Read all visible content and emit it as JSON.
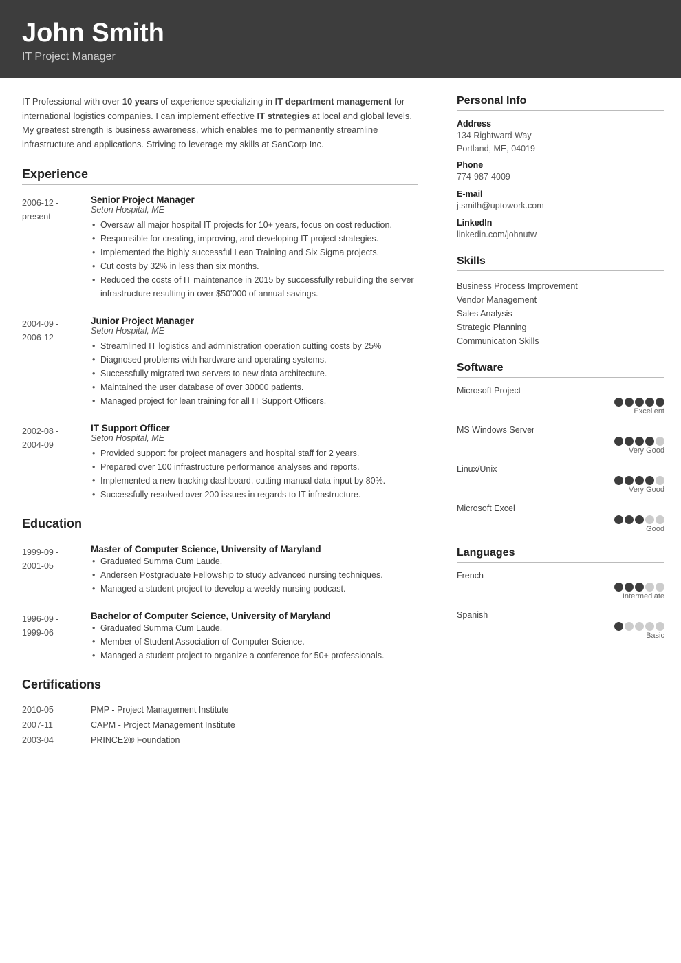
{
  "header": {
    "name": "John Smith",
    "title": "IT Project Manager"
  },
  "summary": {
    "text_parts": [
      {
        "text": "IT Professional with over ",
        "bold": false
      },
      {
        "text": "10 years",
        "bold": true
      },
      {
        "text": " of experience specializing in ",
        "bold": false
      },
      {
        "text": "IT department management",
        "bold": true
      },
      {
        "text": " for international logistics companies. I can implement effective ",
        "bold": false
      },
      {
        "text": "IT strategies",
        "bold": true
      },
      {
        "text": " at local and global levels. My greatest strength is business awareness, which enables me to permanently streamline infrastructure and applications. Striving to leverage my skills at SanCorp Inc.",
        "bold": false
      }
    ]
  },
  "sections": {
    "experience_title": "Experience",
    "education_title": "Education",
    "certifications_title": "Certifications"
  },
  "experience": [
    {
      "date_from": "2006-12 -",
      "date_to": "present",
      "role": "Senior Project Manager",
      "company": "Seton Hospital, ME",
      "bullets": [
        "Oversaw all major hospital IT projects for 10+ years, focus on cost reduction.",
        "Responsible for creating, improving, and developing IT project strategies.",
        "Implemented the highly successful Lean Training and Six Sigma projects.",
        "Cut costs by 32% in less than six months.",
        "Reduced the costs of IT maintenance in 2015 by successfully rebuilding the server infrastructure resulting in over $50'000 of annual savings."
      ]
    },
    {
      "date_from": "2004-09 -",
      "date_to": "2006-12",
      "role": "Junior Project Manager",
      "company": "Seton Hospital, ME",
      "bullets": [
        "Streamlined IT logistics and administration operation cutting costs by 25%",
        "Diagnosed problems with hardware and operating systems.",
        "Successfully migrated two servers to new data architecture.",
        "Maintained the user database of over 30000 patients.",
        "Managed project for lean training for all IT Support Officers."
      ]
    },
    {
      "date_from": "2002-08 -",
      "date_to": "2004-09",
      "role": "IT Support Officer",
      "company": "Seton Hospital, ME",
      "bullets": [
        "Provided support for project managers and hospital staff for 2 years.",
        "Prepared over 100 infrastructure performance analyses and reports.",
        "Implemented a new tracking dashboard, cutting manual data input by 80%.",
        "Successfully resolved over 200 issues in regards to IT infrastructure."
      ]
    }
  ],
  "education": [
    {
      "date_from": "1999-09 -",
      "date_to": "2001-05",
      "role": "Master of Computer Science, University of Maryland",
      "company": null,
      "bullets": [
        "Graduated Summa Cum Laude.",
        "Andersen Postgraduate Fellowship to study advanced nursing techniques.",
        "Managed a student project to develop a weekly nursing podcast."
      ]
    },
    {
      "date_from": "1996-09 -",
      "date_to": "1999-06",
      "role": "Bachelor of Computer Science, University of Maryland",
      "company": null,
      "bullets": [
        "Graduated Summa Cum Laude.",
        "Member of Student Association of Computer Science.",
        "Managed a student project to organize a conference for 50+ professionals."
      ]
    }
  ],
  "certifications": [
    {
      "date": "2010-05",
      "name": "PMP - Project Management Institute"
    },
    {
      "date": "2007-11",
      "name": "CAPM - Project Management Institute"
    },
    {
      "date": "2003-04",
      "name": "PRINCE2® Foundation"
    }
  ],
  "right": {
    "personal_info_title": "Personal Info",
    "personal_info": [
      {
        "label": "Address",
        "value": "134 Rightward Way\nPortland, ME, 04019"
      },
      {
        "label": "Phone",
        "value": "774-987-4009"
      },
      {
        "label": "E-mail",
        "value": "j.smith@uptowork.com"
      },
      {
        "label": "LinkedIn",
        "value": "linkedin.com/johnutw"
      }
    ],
    "skills_title": "Skills",
    "skills": [
      "Business Process Improvement",
      "Vendor Management",
      "Sales Analysis",
      "Strategic Planning",
      "Communication Skills"
    ],
    "software_title": "Software",
    "software": [
      {
        "name": "Microsoft Project",
        "filled": 5,
        "total": 5,
        "label": "Excellent"
      },
      {
        "name": "MS Windows Server",
        "filled": 4,
        "total": 5,
        "label": "Very Good"
      },
      {
        "name": "Linux/Unix",
        "filled": 4,
        "total": 5,
        "label": "Very Good"
      },
      {
        "name": "Microsoft Excel",
        "filled": 3,
        "total": 5,
        "label": "Good"
      }
    ],
    "languages_title": "Languages",
    "languages": [
      {
        "name": "French",
        "filled": 3,
        "total": 5,
        "label": "Intermediate"
      },
      {
        "name": "Spanish",
        "filled": 1,
        "total": 5,
        "label": "Basic"
      }
    ]
  }
}
